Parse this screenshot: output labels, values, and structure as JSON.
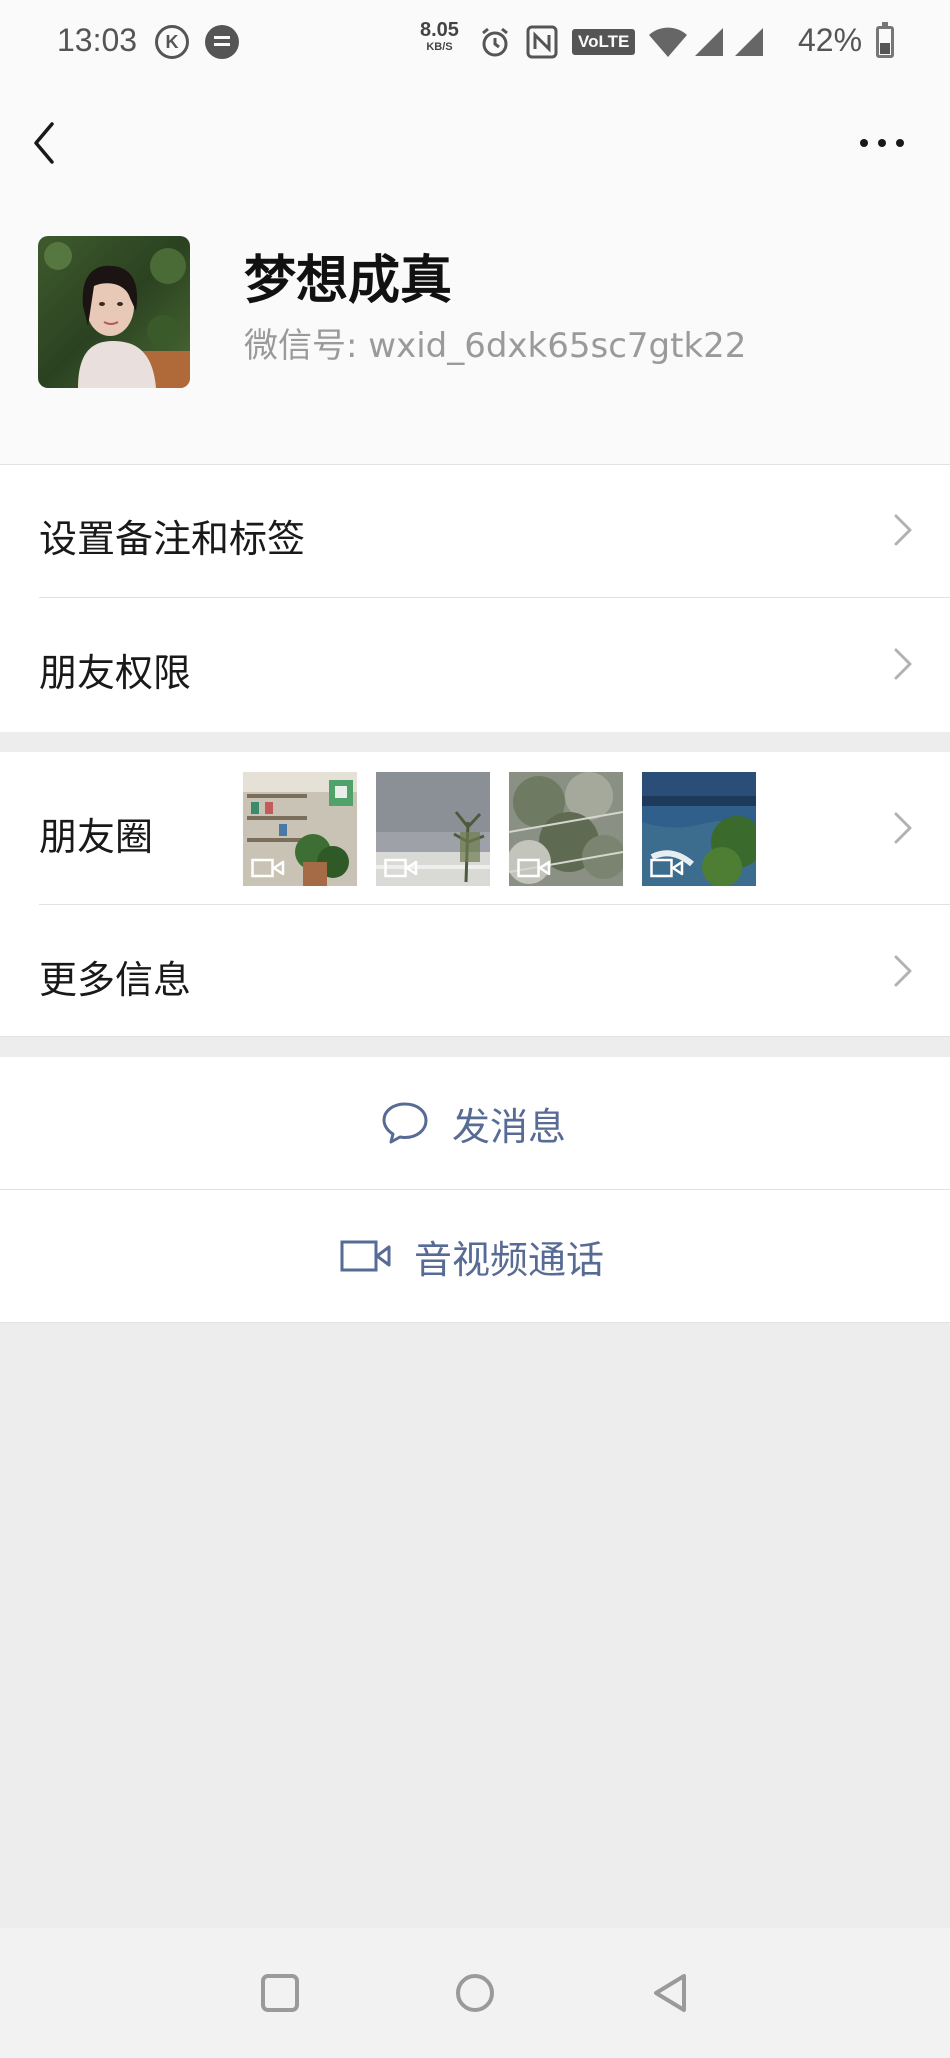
{
  "status_bar": {
    "time": "13:03",
    "speed_value": "8.05",
    "speed_unit": "KB/S",
    "volte": "VoLTE",
    "battery_percent": "42%",
    "battery_level": 0.42
  },
  "nav": {
    "back_icon": "chevron-left-icon",
    "more_icon": "more-horizontal-icon"
  },
  "profile": {
    "name": "梦想成真",
    "wechat_id": "微信号: wxid_6dxk65sc7gtk22"
  },
  "settings_rows": [
    {
      "label": "设置备注和标签"
    },
    {
      "label": "朋友权限"
    }
  ],
  "moments": {
    "label": "朋友圈",
    "thumbnails": [
      {
        "type": "video"
      },
      {
        "type": "video"
      },
      {
        "type": "video"
      },
      {
        "type": "video"
      }
    ]
  },
  "more_info": {
    "label": "更多信息"
  },
  "actions": {
    "send_message": "发消息",
    "video_call": "音视频通话"
  },
  "colors": {
    "link": "#576b95",
    "background": "#ededed"
  }
}
